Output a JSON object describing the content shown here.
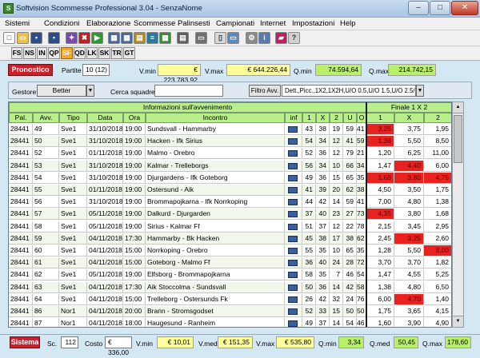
{
  "window": {
    "title": "Softvision Scommesse Professional 3.04 - SenzaNome",
    "minimize": "–",
    "maximize": "□",
    "close": "✕"
  },
  "menu": [
    "Sistemi",
    "Condizioni",
    "Elaborazione",
    "Scommesse",
    "Palinsesti",
    "Campionati",
    "Internet",
    "Impostazioni",
    "Help"
  ],
  "tabs": [
    "FS",
    "NS",
    "IN",
    "QP",
    "SF",
    "QD",
    "LK",
    "SK",
    "TR",
    "GT"
  ],
  "active_tab": "SF",
  "summary": {
    "pronostico_label": "Pronostico",
    "partite_label": "Partite",
    "partite_value": "10 (12)",
    "vmin_label": "V.min",
    "vmin_value": "€ 223.783,92",
    "vmax_label": "V.max",
    "vmax_value": "€ 644.226,44",
    "qmin_label": "Q.min",
    "qmin_value": "74.594,64",
    "qmax_label": "Q.max",
    "qmax_value": "214.742,15"
  },
  "filters": {
    "gestore_label": "Gestore",
    "gestore_value": "Better",
    "cerca_label": "Cerca squadre",
    "cerca_value": "",
    "filtro_label": "Filtro Avv.",
    "filtro_value": "Dett.,Picc.,1X2,1X2H,U/O 0.5,U/O 1.5,U/O 2.5/I"
  },
  "grid": {
    "group_info": "Informazioni sull'avvenimento",
    "group_finale": "Finale 1 X 2",
    "group_extra": "1X2",
    "columns": [
      "Pal.",
      "Avv.",
      "Tipo",
      "Data",
      "Ora",
      "Incontro",
      "inf",
      "1",
      "X",
      "2",
      "U",
      "O",
      "1",
      "X",
      "2",
      "1"
    ],
    "rows": [
      [
        "28441",
        "49",
        "Sve1",
        "31/10/2018",
        "19:00",
        "Sundsvall - Hammarby",
        "43",
        "38",
        "19",
        "59",
        "41",
        "3,25",
        "3,75",
        "1,95",
        "1,75"
      ],
      [
        "28441",
        "50",
        "Sve1",
        "31/10/2018",
        "19:00",
        "Hacken - Ifk Sirius",
        "54",
        "34",
        "12",
        "41",
        "59",
        "1,38",
        "5,50",
        "8,50",
        "1,73"
      ],
      [
        "28441",
        "52",
        "Sve1",
        "01/11/2018",
        "19:00",
        "Malmo - Orebro",
        "52",
        "36",
        "12",
        "79",
        "21",
        "1,20",
        "6,25",
        "11,00",
        "1,58"
      ],
      [
        "28441",
        "53",
        "Sve1",
        "31/10/2018",
        "19:00",
        "Kalmar - Trelleborgs",
        "56",
        "34",
        "10",
        "66",
        "34",
        "1,47",
        "4,40",
        "6,00",
        "2,20"
      ],
      [
        "28441",
        "54",
        "Sve1",
        "31/10/2018",
        "19:00",
        "Djurgardens - Ifk Goteborg",
        "49",
        "36",
        "15",
        "65",
        "35",
        "1,68",
        "3,80",
        "4,75",
        "2,65"
      ],
      [
        "28441",
        "55",
        "Sve1",
        "01/11/2018",
        "19:00",
        "Ostersund - Aik",
        "41",
        "39",
        "20",
        "62",
        "38",
        "4,50",
        "3,50",
        "1,75",
        "1,95"
      ],
      [
        "28441",
        "56",
        "Sve1",
        "31/10/2018",
        "19:00",
        "Brommapojkarna - Ifk Norrkoping",
        "44",
        "42",
        "14",
        "59",
        "41",
        "7,00",
        "4,80",
        "1,38",
        "2,80"
      ],
      [
        "28441",
        "57",
        "Sve1",
        "05/11/2018",
        "19:00",
        "Dalkurd - Djurgarden",
        "37",
        "40",
        "23",
        "27",
        "73",
        "4,35",
        "3,80",
        "1,68",
        ""
      ],
      [
        "28441",
        "58",
        "Sve1",
        "05/11/2018",
        "19:00",
        "Sirius - Kalmar Ff",
        "51",
        "37",
        "12",
        "22",
        "78",
        "2,15",
        "3,45",
        "2,95",
        ""
      ],
      [
        "28441",
        "59",
        "Sve1",
        "04/11/2018",
        "17:30",
        "Hammarby - Bk Hacken",
        "45",
        "38",
        "17",
        "38",
        "62",
        "2,45",
        "3,25",
        "2,60",
        "4,50"
      ],
      [
        "28441",
        "60",
        "Sve1",
        "04/11/2018",
        "15:00",
        "Norrkoping - Orebro",
        "55",
        "35",
        "10",
        "65",
        "35",
        "1,28",
        "5,50",
        "8,00",
        "1,77"
      ],
      [
        "28441",
        "61",
        "Sve1",
        "04/11/2018",
        "15:00",
        "Goteborg - Malmo Ff",
        "36",
        "40",
        "24",
        "28",
        "72",
        "3,70",
        "3,70",
        "1,82",
        ""
      ],
      [
        "28441",
        "62",
        "Sve1",
        "05/11/2018",
        "19:00",
        "Elfsborg - Brommapojkarna",
        "58",
        "35",
        "7",
        "46",
        "54",
        "1,47",
        "4,55",
        "5,25",
        "2,25"
      ],
      [
        "28441",
        "63",
        "Sve1",
        "04/11/2018",
        "17:30",
        "Aik Stoccolma - Sundsvall",
        "50",
        "36",
        "14",
        "42",
        "58",
        "1,38",
        "4,80",
        "6,50",
        "2,00"
      ],
      [
        "28441",
        "64",
        "Sve1",
        "04/11/2018",
        "15:00",
        "Trelleborg - Ostersunds Fk",
        "26",
        "42",
        "32",
        "24",
        "76",
        "6,00",
        "4,70",
        "1,40",
        "2,65"
      ],
      [
        "28441",
        "86",
        "Nor1",
        "04/11/2018",
        "20:00",
        "Brann - Stromsgodset",
        "52",
        "33",
        "15",
        "50",
        "50",
        "1,75",
        "3,65",
        "4,15",
        "2,90"
      ],
      [
        "28441",
        "87",
        "Nor1",
        "04/11/2018",
        "18:00",
        "Haugesund - Ranheim",
        "49",
        "37",
        "14",
        "54",
        "46",
        "1,60",
        "3,90",
        "4,90",
        "2,50"
      ]
    ],
    "red_cells": [
      [
        0,
        11
      ],
      [
        1,
        11
      ],
      [
        2,
        14
      ],
      [
        3,
        12
      ],
      [
        4,
        11
      ],
      [
        4,
        12
      ],
      [
        4,
        13
      ],
      [
        6,
        14
      ],
      [
        7,
        11
      ],
      [
        9,
        12
      ],
      [
        10,
        13
      ],
      [
        14,
        12
      ]
    ]
  },
  "status": {
    "sistema_label": "Sistema",
    "sc_label": "Sc.",
    "sc_value": "112",
    "costo_label": "Costo",
    "costo_value": "€ 336,00",
    "vmin_label": "V.min",
    "vmin_value": "€ 10,01",
    "vmed_label": "V.med",
    "vmed_value": "€ 151,35",
    "vmax_label": "V.max",
    "vmax_value": "€ 535,80",
    "qmin_label": "Q.min",
    "qmin_value": "3,34",
    "qmed_label": "Q.med",
    "qmed_value": "50,45",
    "qmax_label": "Q.max",
    "qmax_value": "178,60"
  },
  "colors": {
    "accent": "#f5a623",
    "red": "#c9202a",
    "green_header": "#b9ef8b",
    "yellow_field": "#fffe9a",
    "green_field": "#b8f06a"
  }
}
